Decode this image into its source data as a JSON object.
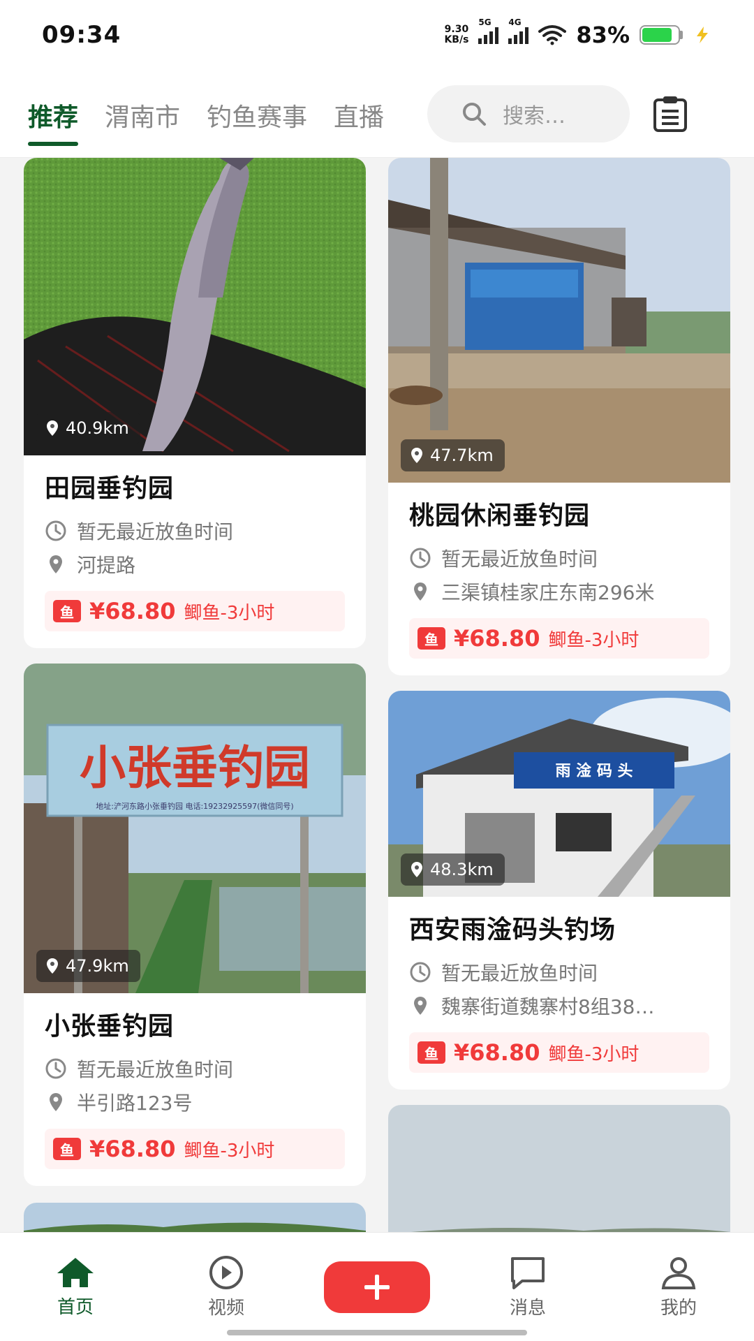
{
  "status_bar": {
    "time": "09:34",
    "net_speed_value": "9.30",
    "net_speed_unit": "KB/s",
    "signal_1_label": "5G",
    "signal_2_label": "4G",
    "battery_percent": "83%",
    "battery_level": 0.83
  },
  "header": {
    "tabs": [
      {
        "label": "推荐",
        "active": true
      },
      {
        "label": "渭南市",
        "active": false
      },
      {
        "label": "钓鱼赛事",
        "active": false
      },
      {
        "label": "直播",
        "active": false
      }
    ],
    "search_placeholder": "搜索…",
    "search_icon": "search-icon",
    "clipboard_icon": "clipboard-icon"
  },
  "spots": [
    {
      "name": "田园垂钓园",
      "distance": "40.9km",
      "release_time": "暂无最近放鱼时间",
      "address": "河提路",
      "price_tag": "鱼",
      "price": "¥68.80",
      "price_desc": "鲫鱼-3小时"
    },
    {
      "name": "桃园休闲垂钓园",
      "distance": "47.7km",
      "release_time": "暂无最近放鱼时间",
      "address": "三渠镇桂家庄东南296米",
      "price_tag": "鱼",
      "price": "¥68.80",
      "price_desc": "鲫鱼-3小时"
    },
    {
      "name": "小张垂钓园",
      "distance": "47.9km",
      "release_time": "暂无最近放鱼时间",
      "address": "半引路123号",
      "price_tag": "鱼",
      "price": "¥68.80",
      "price_desc": "鲫鱼-3小时",
      "sign_text": "小张垂钓园",
      "sign_subtext": "地址:浐河东路小张垂钓园   电话:19232925597(微信同号)"
    },
    {
      "name": "西安雨淦码头钓场",
      "distance": "48.3km",
      "release_time": "暂无最近放鱼时间",
      "address": "魏寨街道魏寨村8组38…",
      "price_tag": "鱼",
      "price": "¥68.80",
      "price_desc": "鲫鱼-3小时",
      "sign_text": "雨 淦 码 头"
    }
  ],
  "bottom_nav": [
    {
      "label": "首页",
      "icon": "home-icon",
      "active": true
    },
    {
      "label": "视频",
      "icon": "play-icon",
      "active": false
    },
    {
      "label": "",
      "icon": "plus-icon",
      "active": false
    },
    {
      "label": "消息",
      "icon": "message-icon",
      "active": false
    },
    {
      "label": "我的",
      "icon": "user-icon",
      "active": false
    }
  ],
  "colors": {
    "brand_green": "#0f5a2a",
    "price_red": "#f03a3a",
    "price_bg": "#fff2f2"
  }
}
